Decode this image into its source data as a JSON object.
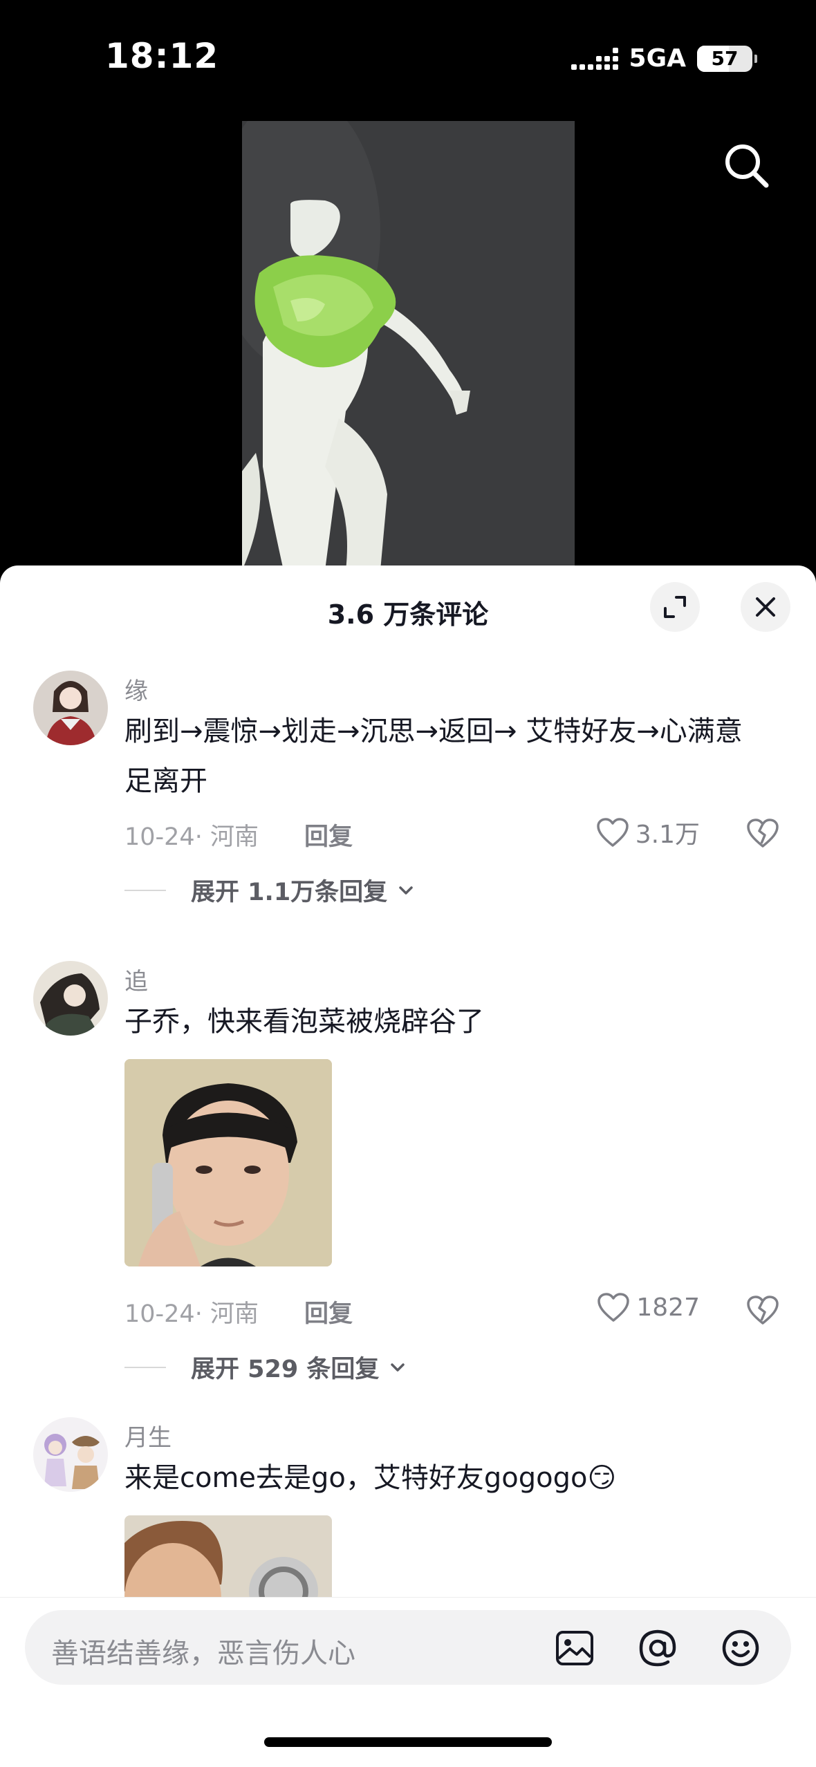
{
  "status": {
    "time": "18:12",
    "network": "5GA",
    "battery": "57",
    "battery_level": 0.57
  },
  "sheet": {
    "title": "3.6 万条评论"
  },
  "comments": [
    {
      "user": "缘",
      "text": "刷到→震惊→划走→沉思→返回→ 艾特好友→心满意足离开",
      "meta": "10-24· 河南",
      "reply": "回复",
      "likes": "3.1万",
      "expand": "展开 1.1万条回复"
    },
    {
      "user": "追",
      "text": "子乔，快来看泡菜被烧辟谷了",
      "meta": "10-24· 河南",
      "reply": "回复",
      "likes": "1827",
      "expand": "展开 529 条回复"
    },
    {
      "user": "月生",
      "text": "来是come去是go，艾特好友gogogo😏"
    }
  ],
  "input": {
    "placeholder": "善语结善缘，恶言伤人心"
  },
  "icons": {
    "search": "search-icon",
    "expand": "expand-icon",
    "close": "close-icon",
    "like": "heart-icon",
    "dislike": "broken-heart-icon",
    "image": "image-icon",
    "mention": "at-icon",
    "emoji": "emoji-icon"
  }
}
